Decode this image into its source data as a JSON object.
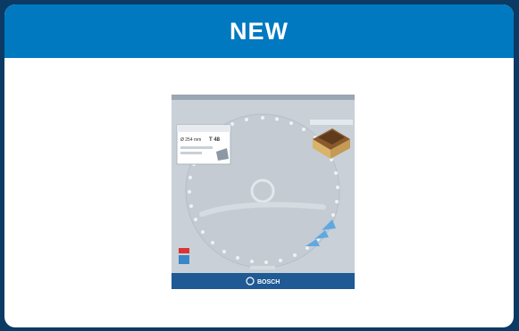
{
  "card": {
    "badge_label": "NEW"
  },
  "product": {
    "packaging": {
      "label_title": "Ø 254 mm",
      "teeth_badge": "T 48",
      "brand": "BOSCH",
      "accent_color": "#1f5a94",
      "disc_color": "#c4cbd3"
    }
  },
  "colors": {
    "outer_bg": "#0b3a64",
    "header_bg": "#0079c1",
    "card_bg": "#ffffff"
  }
}
